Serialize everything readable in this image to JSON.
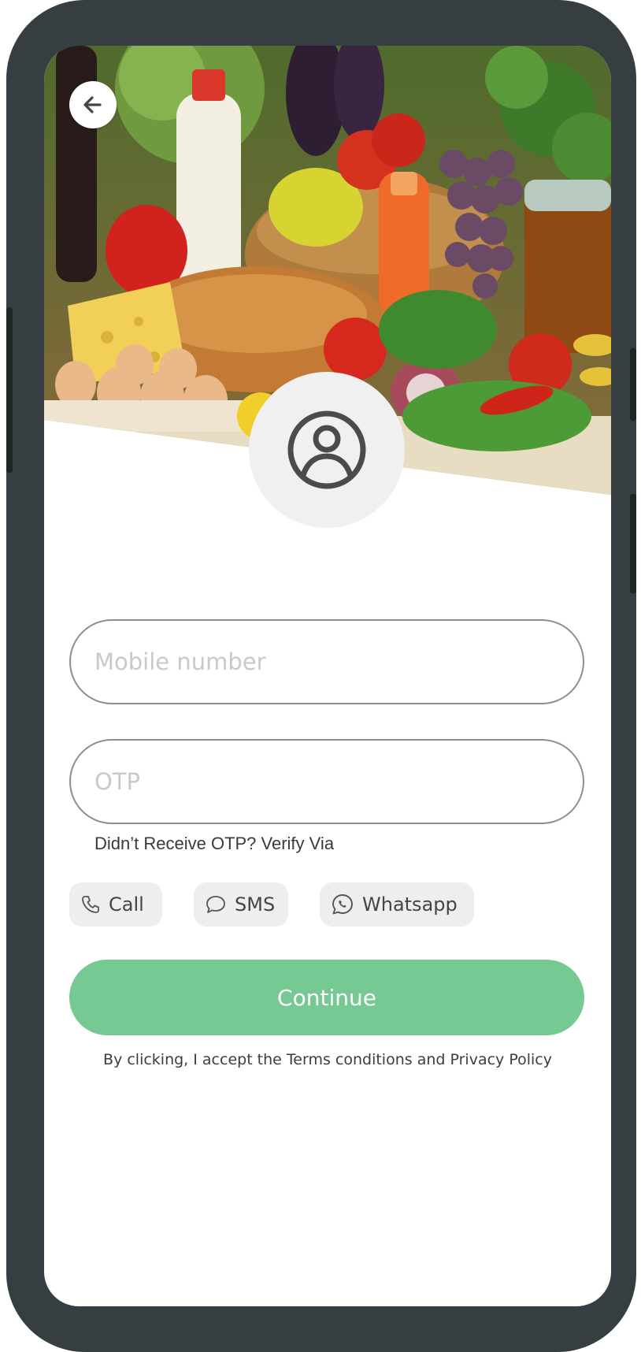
{
  "header": {
    "back_icon": "arrow-left-icon",
    "avatar_icon": "user-circle-icon"
  },
  "form": {
    "mobile_placeholder": "Mobile number",
    "mobile_value": "",
    "otp_placeholder": "OTP",
    "otp_value": ""
  },
  "verify": {
    "prompt": "Didn’t Receive OTP? Verify Via",
    "options": [
      {
        "label": "Call",
        "icon": "phone-icon"
      },
      {
        "label": "SMS",
        "icon": "chat-bubble-icon"
      },
      {
        "label": "Whatsapp",
        "icon": "whatsapp-icon"
      }
    ]
  },
  "actions": {
    "continue_label": "Continue"
  },
  "terms": {
    "prefix": "By clicking, I accept the ",
    "terms_link": "Terms conditions",
    "middle": " and ",
    "privacy_link": "Privacy Policy"
  },
  "colors": {
    "accent": "#76c992",
    "device_frame": "#373e42",
    "input_border": "#8e8e8e",
    "chip_bg": "#eeeeee"
  }
}
